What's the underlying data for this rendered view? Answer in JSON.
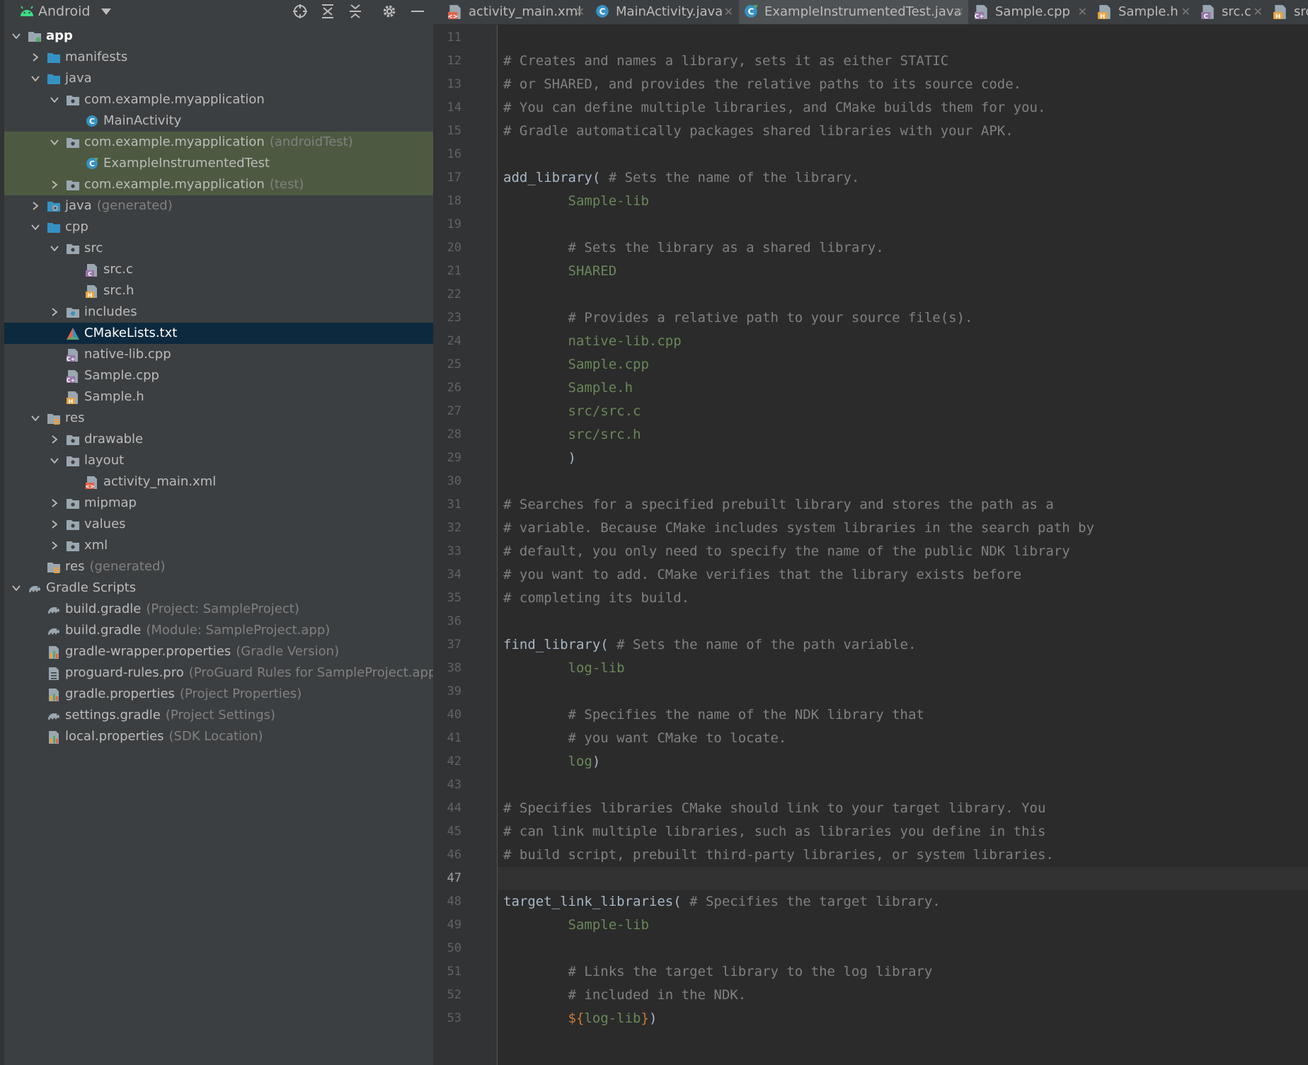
{
  "sidebar": {
    "view_name": "Android",
    "tree": [
      {
        "label": "app",
        "suffix": "",
        "indent": 0,
        "expanded": true,
        "icon": "module-folder-icon",
        "bold": true
      },
      {
        "label": "manifests",
        "suffix": "",
        "indent": 1,
        "expanded": false,
        "icon": "folder-icon"
      },
      {
        "label": "java",
        "suffix": "",
        "indent": 1,
        "expanded": true,
        "icon": "folder-icon"
      },
      {
        "label": "com.example.myapplication",
        "suffix": "",
        "indent": 2,
        "expanded": true,
        "icon": "package-icon"
      },
      {
        "label": "MainActivity",
        "suffix": "",
        "indent": 3,
        "icon": "class-icon"
      },
      {
        "label": "com.example.myapplication",
        "suffix": "(androidTest)",
        "indent": 2,
        "expanded": true,
        "icon": "package-icon",
        "highlight": "green"
      },
      {
        "label": "ExampleInstrumentedTest",
        "suffix": "",
        "indent": 3,
        "icon": "test-class-icon",
        "highlight": "green"
      },
      {
        "label": "com.example.myapplication",
        "suffix": "(test)",
        "indent": 2,
        "expanded": false,
        "icon": "package-icon",
        "highlight": "green"
      },
      {
        "label": "java",
        "suffix": "(generated)",
        "indent": 1,
        "expanded": false,
        "icon": "generated-folder-icon"
      },
      {
        "label": "cpp",
        "suffix": "",
        "indent": 1,
        "expanded": true,
        "icon": "folder-icon"
      },
      {
        "label": "src",
        "suffix": "",
        "indent": 2,
        "expanded": true,
        "icon": "package-icon"
      },
      {
        "label": "src.c",
        "suffix": "",
        "indent": 3,
        "icon": "c-file-icon"
      },
      {
        "label": "src.h",
        "suffix": "",
        "indent": 3,
        "icon": "h-file-icon"
      },
      {
        "label": "includes",
        "suffix": "",
        "indent": 2,
        "expanded": false,
        "icon": "includes-folder-icon"
      },
      {
        "label": "CMakeLists.txt",
        "suffix": "",
        "indent": 2,
        "icon": "cmake-icon",
        "highlight": "selected"
      },
      {
        "label": "native-lib.cpp",
        "suffix": "",
        "indent": 2,
        "icon": "cpp-file-icon"
      },
      {
        "label": "Sample.cpp",
        "suffix": "",
        "indent": 2,
        "icon": "cpp-file-icon"
      },
      {
        "label": "Sample.h",
        "suffix": "",
        "indent": 2,
        "icon": "h-file-icon"
      },
      {
        "label": "res",
        "suffix": "",
        "indent": 1,
        "expanded": true,
        "icon": "res-folder-icon"
      },
      {
        "label": "drawable",
        "suffix": "",
        "indent": 2,
        "expanded": false,
        "icon": "package-icon"
      },
      {
        "label": "layout",
        "suffix": "",
        "indent": 2,
        "expanded": true,
        "icon": "package-icon"
      },
      {
        "label": "activity_main.xml",
        "suffix": "",
        "indent": 3,
        "icon": "xml-file-icon"
      },
      {
        "label": "mipmap",
        "suffix": "",
        "indent": 2,
        "expanded": false,
        "icon": "package-icon"
      },
      {
        "label": "values",
        "suffix": "",
        "indent": 2,
        "expanded": false,
        "icon": "package-icon"
      },
      {
        "label": "xml",
        "suffix": "",
        "indent": 2,
        "expanded": false,
        "icon": "package-icon"
      },
      {
        "label": "res",
        "suffix": "(generated)",
        "indent": 1,
        "icon": "res-folder-icon"
      },
      {
        "label": "Gradle Scripts",
        "suffix": "",
        "indent": 0,
        "expanded": true,
        "icon": "gradle-icon"
      },
      {
        "label": "build.gradle",
        "suffix": "(Project: SampleProject)",
        "indent": 1,
        "icon": "gradle-icon"
      },
      {
        "label": "build.gradle",
        "suffix": "(Module: SampleProject.app)",
        "indent": 1,
        "icon": "gradle-icon"
      },
      {
        "label": "gradle-wrapper.properties",
        "suffix": "(Gradle Version)",
        "indent": 1,
        "icon": "properties-icon"
      },
      {
        "label": "proguard-rules.pro",
        "suffix": "(ProGuard Rules for SampleProject.app)",
        "indent": 1,
        "icon": "text-file-icon"
      },
      {
        "label": "gradle.properties",
        "suffix": "(Project Properties)",
        "indent": 1,
        "icon": "properties-icon"
      },
      {
        "label": "settings.gradle",
        "suffix": "(Project Settings)",
        "indent": 1,
        "icon": "gradle-icon"
      },
      {
        "label": "local.properties",
        "suffix": "(SDK Location)",
        "indent": 1,
        "icon": "properties-icon"
      }
    ]
  },
  "tabs": [
    {
      "label": "activity_main.xml",
      "icon": "xml-file-icon",
      "closable": true
    },
    {
      "label": "MainActivity.java",
      "icon": "class-icon",
      "closable": true
    },
    {
      "label": "ExampleInstrumentedTest.java",
      "icon": "test-class-icon",
      "closable": true,
      "active": true
    },
    {
      "label": "Sample.cpp",
      "icon": "cpp-file-icon",
      "closable": true
    },
    {
      "label": "Sample.h",
      "icon": "h-file-icon",
      "closable": true
    },
    {
      "label": "src.c",
      "icon": "c-file-icon",
      "closable": true
    },
    {
      "label": "src",
      "icon": "h-file-icon",
      "closable": false
    }
  ],
  "editor": {
    "current_line": 47,
    "lines": [
      {
        "n": 11,
        "parts": []
      },
      {
        "n": 12,
        "parts": [
          {
            "t": "# Creates and names a library, sets it as either STATIC",
            "k": "c"
          }
        ]
      },
      {
        "n": 13,
        "parts": [
          {
            "t": "# or SHARED, and provides the relative paths to its source code.",
            "k": "c"
          }
        ]
      },
      {
        "n": 14,
        "parts": [
          {
            "t": "# You can define multiple libraries, and CMake builds them for you.",
            "k": "c"
          }
        ]
      },
      {
        "n": 15,
        "parts": [
          {
            "t": "# Gradle automatically packages shared libraries with your APK.",
            "k": "c"
          }
        ]
      },
      {
        "n": 16,
        "parts": []
      },
      {
        "n": 17,
        "parts": [
          {
            "t": "add_library(",
            "k": "fn"
          },
          {
            "t": " # Sets the name of the library.",
            "k": "c"
          }
        ]
      },
      {
        "n": 18,
        "parts": [
          {
            "t": "        ",
            "k": "p"
          },
          {
            "t": "Sample-lib",
            "k": "arg"
          }
        ]
      },
      {
        "n": 19,
        "parts": []
      },
      {
        "n": 20,
        "parts": [
          {
            "t": "        # Sets the library as a shared library.",
            "k": "c"
          }
        ]
      },
      {
        "n": 21,
        "parts": [
          {
            "t": "        ",
            "k": "p"
          },
          {
            "t": "SHARED",
            "k": "arg"
          }
        ]
      },
      {
        "n": 22,
        "parts": []
      },
      {
        "n": 23,
        "parts": [
          {
            "t": "        # Provides a relative path to your source file(s).",
            "k": "c"
          }
        ]
      },
      {
        "n": 24,
        "parts": [
          {
            "t": "        ",
            "k": "p"
          },
          {
            "t": "native-lib.cpp",
            "k": "arg"
          }
        ]
      },
      {
        "n": 25,
        "parts": [
          {
            "t": "        ",
            "k": "p"
          },
          {
            "t": "Sample.cpp",
            "k": "arg"
          }
        ]
      },
      {
        "n": 26,
        "parts": [
          {
            "t": "        ",
            "k": "p"
          },
          {
            "t": "Sample.h",
            "k": "arg"
          }
        ]
      },
      {
        "n": 27,
        "parts": [
          {
            "t": "        ",
            "k": "p"
          },
          {
            "t": "src/src.c",
            "k": "arg"
          }
        ]
      },
      {
        "n": 28,
        "parts": [
          {
            "t": "        ",
            "k": "p"
          },
          {
            "t": "src/src.h",
            "k": "arg"
          }
        ]
      },
      {
        "n": 29,
        "parts": [
          {
            "t": "        )",
            "k": "p"
          }
        ]
      },
      {
        "n": 30,
        "parts": []
      },
      {
        "n": 31,
        "parts": [
          {
            "t": "# Searches for a specified prebuilt library and stores the path as a",
            "k": "c"
          }
        ]
      },
      {
        "n": 32,
        "parts": [
          {
            "t": "# variable. Because CMake includes system libraries in the search path by",
            "k": "c"
          }
        ]
      },
      {
        "n": 33,
        "parts": [
          {
            "t": "# default, you only need to specify the name of the public NDK library",
            "k": "c"
          }
        ]
      },
      {
        "n": 34,
        "parts": [
          {
            "t": "# you want to add. CMake verifies that the library exists before",
            "k": "c"
          }
        ]
      },
      {
        "n": 35,
        "parts": [
          {
            "t": "# completing its build.",
            "k": "c"
          }
        ]
      },
      {
        "n": 36,
        "parts": []
      },
      {
        "n": 37,
        "parts": [
          {
            "t": "find_library(",
            "k": "fn"
          },
          {
            "t": " # Sets the name of the path variable.",
            "k": "c"
          }
        ]
      },
      {
        "n": 38,
        "parts": [
          {
            "t": "        ",
            "k": "p"
          },
          {
            "t": "log-lib",
            "k": "arg"
          }
        ]
      },
      {
        "n": 39,
        "parts": []
      },
      {
        "n": 40,
        "parts": [
          {
            "t": "        # Specifies the name of the NDK library that",
            "k": "c"
          }
        ]
      },
      {
        "n": 41,
        "parts": [
          {
            "t": "        # you want CMake to locate.",
            "k": "c"
          }
        ]
      },
      {
        "n": 42,
        "parts": [
          {
            "t": "        ",
            "k": "p"
          },
          {
            "t": "log",
            "k": "arg"
          },
          {
            "t": ")",
            "k": "p"
          }
        ]
      },
      {
        "n": 43,
        "parts": []
      },
      {
        "n": 44,
        "parts": [
          {
            "t": "# Specifies libraries CMake should link to your target library. You",
            "k": "c"
          }
        ]
      },
      {
        "n": 45,
        "parts": [
          {
            "t": "# can link multiple libraries, such as libraries you define in this",
            "k": "c"
          }
        ]
      },
      {
        "n": 46,
        "parts": [
          {
            "t": "# build script, prebuilt third-party libraries, or system libraries.",
            "k": "c"
          }
        ]
      },
      {
        "n": 47,
        "parts": []
      },
      {
        "n": 48,
        "parts": [
          {
            "t": "target_link_libraries(",
            "k": "fn"
          },
          {
            "t": " # Specifies the target library.",
            "k": "c"
          }
        ]
      },
      {
        "n": 49,
        "parts": [
          {
            "t": "        ",
            "k": "p"
          },
          {
            "t": "Sample-lib",
            "k": "arg"
          }
        ]
      },
      {
        "n": 50,
        "parts": []
      },
      {
        "n": 51,
        "parts": [
          {
            "t": "        # Links the target library to the log library",
            "k": "c"
          }
        ]
      },
      {
        "n": 52,
        "parts": [
          {
            "t": "        # included in the NDK.",
            "k": "c"
          }
        ]
      },
      {
        "n": 53,
        "parts": [
          {
            "t": "        ",
            "k": "p"
          },
          {
            "t": "${",
            "k": "dollar"
          },
          {
            "t": "log-lib",
            "k": "arg"
          },
          {
            "t": "}",
            "k": "dollar"
          },
          {
            "t": ")",
            "k": "p"
          }
        ]
      }
    ]
  },
  "colors": {
    "panel_bg": "#3c3f41",
    "editor_bg": "#2b2b2b",
    "selection": "#0d293e",
    "test_highlight": "#4d5a41",
    "comment": "#808080",
    "string_arg": "#6a8759",
    "keyword": "#cc7832"
  }
}
